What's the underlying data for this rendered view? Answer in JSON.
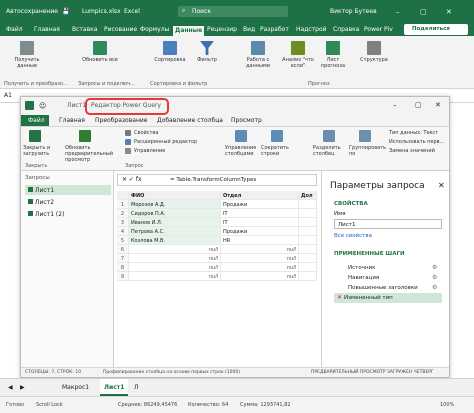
{
  "excel": {
    "quick_access": [
      "Автосохранение",
      "💾"
    ],
    "file_name": "Lumpics.xlsx",
    "app": "Excel",
    "search": "Поиск",
    "user": "Виктор Бутеев",
    "tabs": [
      "Файл",
      "Главная",
      "Вставка",
      "Рисование",
      "Формулы",
      "Данные",
      "Рецензир",
      "Вид",
      "Разработ",
      "Надстрой",
      "Справка",
      "Power Piv"
    ],
    "share": "Поделиться",
    "ribbon": {
      "get_data": "Получить данные",
      "refresh_all": "Обновить все",
      "sort": "Сортировка",
      "filter": "Фильтр",
      "text_to_columns": "Работа с данными",
      "whatif": "Анализ \"что если\"",
      "forecast": "Лист прогноза",
      "outline": "Структура",
      "groups": [
        "Получить и преобразо...",
        "Запросы и подключ...",
        "Сортировка и фильтр",
        "Прогноз"
      ]
    },
    "name_box": "A1",
    "sheets": [
      "Макрос1",
      "Лист1",
      "Л"
    ],
    "status": {
      "ready": "Готово",
      "scroll_lock": "Scroll Lock",
      "avg": "Среднее: 86249,45476",
      "count": "Количество: 64",
      "sum": "Сумма: 1293741,82",
      "zoom": "100%"
    }
  },
  "pq": {
    "title_prefix": "Лист1",
    "title": "Редактор Power Query",
    "tabs": [
      "Файл",
      "Главная",
      "Преобразование",
      "Добавление столбца",
      "Просмотр"
    ],
    "ribbon": {
      "close_load": "Закрыть и загрузить",
      "refresh_preview": "Обновить предварительный просмотр",
      "properties": "Свойства",
      "advanced_editor": "Расширенный редактор",
      "manage": "Управление",
      "manage_columns": "Управление столбцами",
      "reduce_rows": "Сократить строки",
      "split_column": "Разделить столбец",
      "group_by": "Группировать по",
      "data_type": "Тип данных: Текст",
      "first_row_headers": "Использовать перв...",
      "replace_values": "Замена значений",
      "grp_close": "Закрыть",
      "grp_query": "Запрос"
    },
    "queries_label": "Запросы",
    "queries": [
      "Лист1",
      "Лист2",
      "Лист1 (2)"
    ],
    "formula": "= Table.TransformColumnTypes",
    "columns": [
      "ФИО",
      "Отдел",
      "Дол"
    ],
    "rows": [
      [
        "Морозов А.Д.",
        "Продажи",
        ""
      ],
      [
        "Сидоров П.А.",
        "IT",
        ""
      ],
      [
        "Иванов И.Л.",
        "IT",
        ""
      ],
      [
        "Петрова А.С.",
        "Продажи",
        ""
      ],
      [
        "Козлова М.В.",
        "HR",
        ""
      ],
      [
        "null",
        "null",
        ""
      ],
      [
        "null",
        "null",
        ""
      ],
      [
        "null",
        "null",
        ""
      ],
      [
        "null",
        "null",
        ""
      ]
    ],
    "params": {
      "title": "Параметры запроса",
      "properties": "СВОЙСТВА",
      "name_label": "Имя",
      "name_value": "Лист1",
      "all_props": "Все свойства",
      "applied_steps": "ПРИМЕНЕННЫЕ ШАГИ",
      "steps": [
        "Источник",
        "Навигация",
        "Повышенные заголовки",
        "Измененный тип"
      ]
    },
    "status": {
      "left": "СТОЛБЦЫ: 7, СТРОК: 10",
      "mid": "Профилирование столбца на основе первых строк (1000)",
      "right": "ПРЕДВАРИТЕЛЬНЫЙ ПРОСМОТР ЗАГРУЖЕН ЧЕТВЕРГ"
    }
  },
  "colors": {
    "excel_green": "#1e7145",
    "pq_blue": "#217346",
    "highlight": "#e53935",
    "selected": "#cfe6d8"
  }
}
